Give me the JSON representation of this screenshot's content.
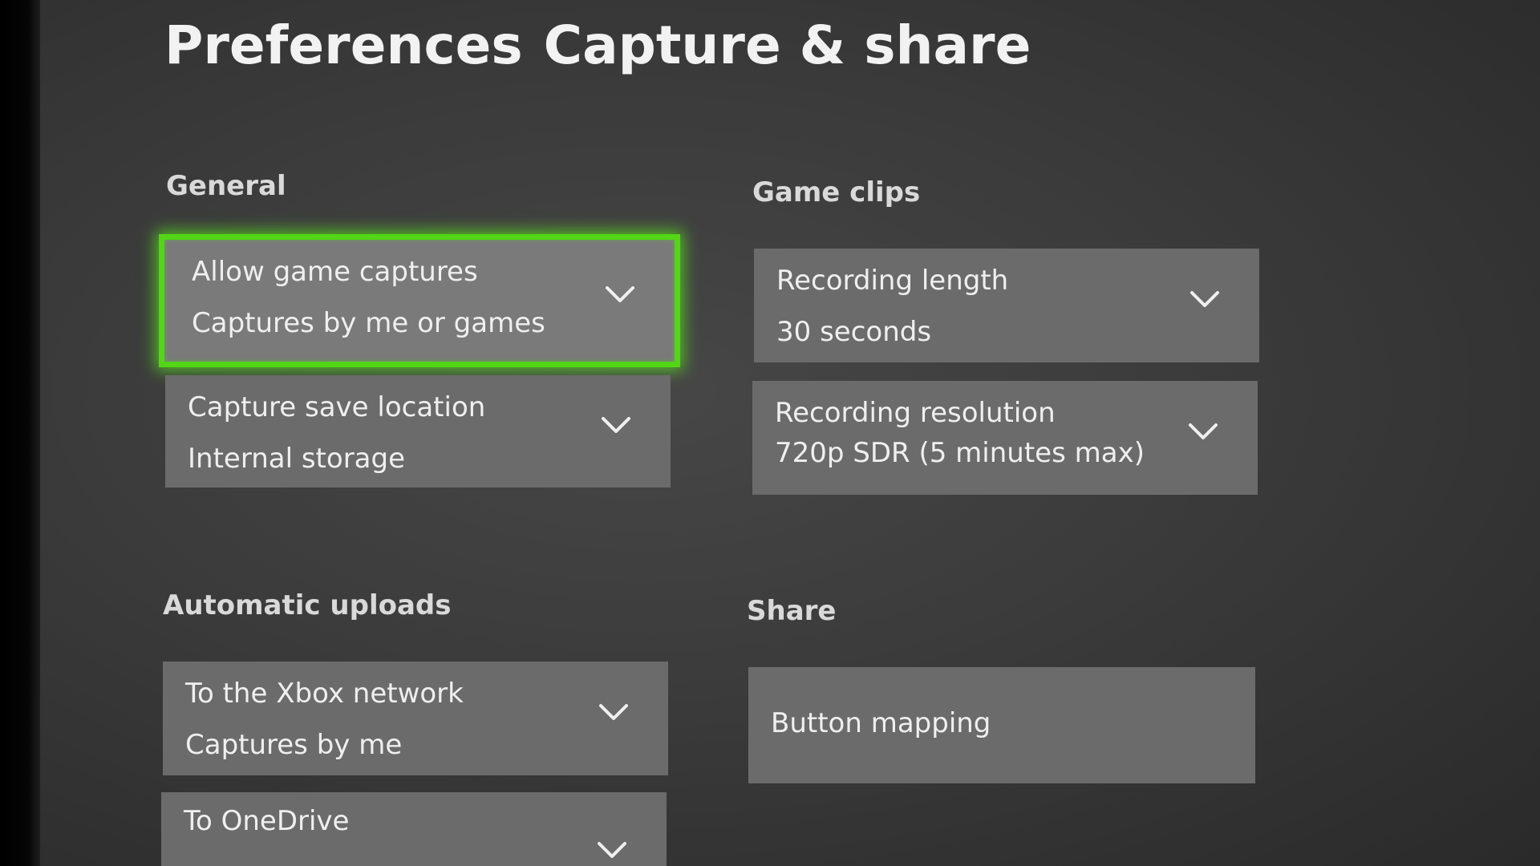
{
  "header": {
    "title_left": "Preferences",
    "title_right": "Capture & share"
  },
  "sections": {
    "general": {
      "label": "General",
      "items": [
        {
          "title": "Allow game captures",
          "value": "Captures by me or games"
        },
        {
          "title": "Capture save location",
          "value": "Internal storage"
        }
      ]
    },
    "game_clips": {
      "label": "Game clips",
      "items": [
        {
          "title": "Recording length",
          "value": "30 seconds"
        },
        {
          "title": "Recording resolution",
          "value": "720p SDR (5 minutes max)"
        }
      ]
    },
    "automatic_uploads": {
      "label": "Automatic uploads",
      "items": [
        {
          "title": "To the Xbox network",
          "value": "Captures by me"
        },
        {
          "title": "To OneDrive",
          "value": ""
        }
      ]
    },
    "share": {
      "label": "Share",
      "items": [
        {
          "title": "Button mapping"
        }
      ]
    }
  },
  "colors": {
    "focus_ring": "#52d616",
    "tile": "#6b6b6b",
    "background": "#3b3b3b"
  },
  "icons": {
    "dropdown": "chevron-down-icon"
  }
}
